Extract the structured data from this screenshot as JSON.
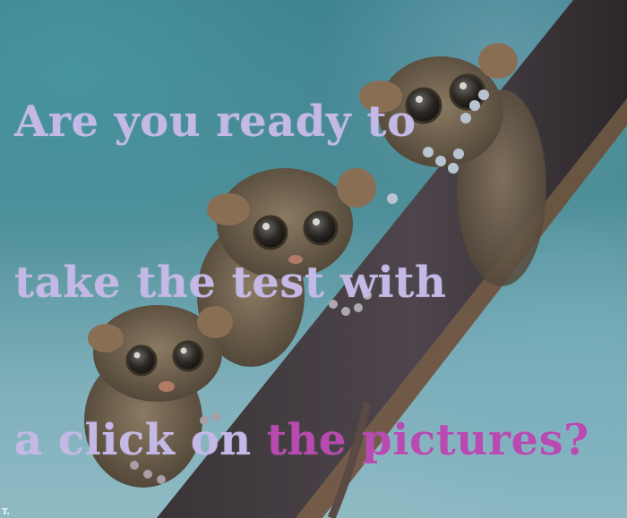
{
  "caption": {
    "line1": "Are you ready to",
    "line2": "take the test with",
    "line3_plain": "a click on ",
    "line3_accent": "the pictures?"
  },
  "watermark": "T.",
  "colors": {
    "caption_text": "#c4b9e6",
    "caption_accent": "#b84ab2",
    "background_teal": "#3f8390",
    "branch": "#4a4248",
    "fur": "#7c6c56"
  },
  "photo": {
    "subject": "three tarsiers clinging to a diagonal branch"
  }
}
